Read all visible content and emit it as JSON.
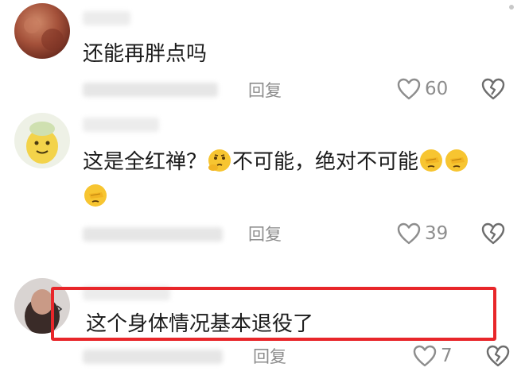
{
  "comments": [
    {
      "text": "还能再胖点吗",
      "reply_label": "回复",
      "like_count": "60"
    },
    {
      "text_part1": "这是全红禅？",
      "text_part2": "不可能，绝对不可能",
      "reply_label": "回复",
      "like_count": "39",
      "emojis": [
        "thinking-emoji",
        "facepalm-emoji"
      ]
    },
    {
      "text": "这个身体情况基本退役了",
      "reply_label": "回复",
      "like_count": "7"
    }
  ],
  "colors": {
    "highlight": "#e8262a",
    "secondary_text": "#8d8d8d",
    "primary_text": "#1b1b1b",
    "emoji_yellow": "#f7c531"
  }
}
